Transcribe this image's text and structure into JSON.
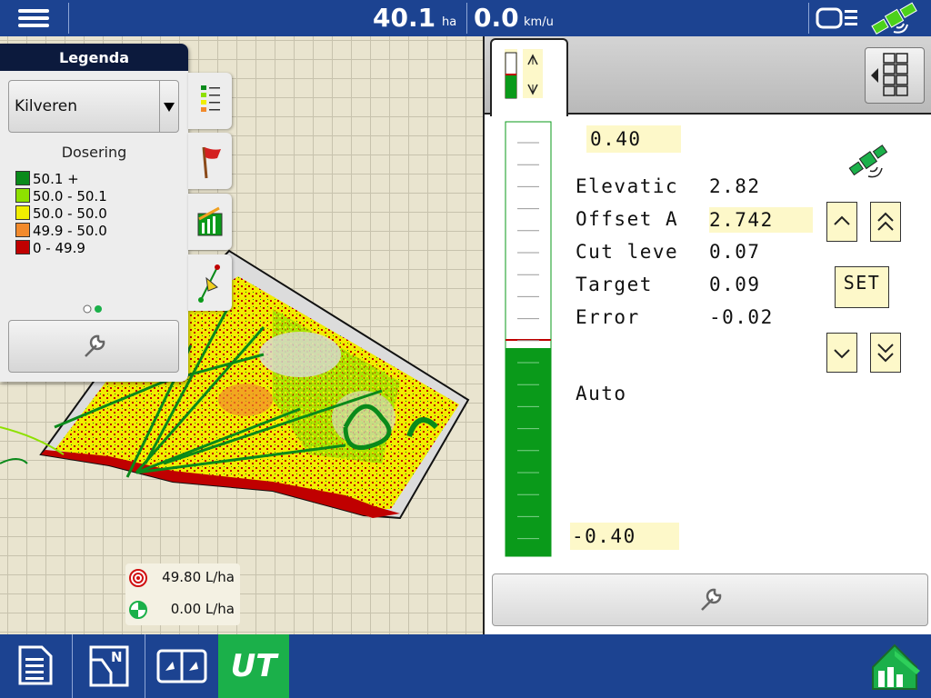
{
  "topbar": {
    "area_value": "40.1",
    "area_unit": "ha",
    "speed_value": "0.0",
    "speed_unit": "km/u",
    "icons": [
      "menu-icon",
      "implement-icon",
      "gps-satellite-icon"
    ]
  },
  "legend": {
    "title": "Legenda",
    "layer": "Kilveren",
    "subtitle": "Dosering",
    "items": [
      {
        "label": "50.1 +",
        "color": "#0a8a1a"
      },
      {
        "label": "50.0 - 50.1",
        "color": "#8ee000"
      },
      {
        "label": "50.0 - 50.0",
        "color": "#f0ee00"
      },
      {
        "label": "49.9 - 50.0",
        "color": "#f28a2c"
      },
      {
        "label": "0 - 49.9",
        "color": "#c00000"
      }
    ],
    "side_tabs": [
      "legend-list-icon",
      "flag-icon",
      "chart-icon",
      "guidance-icon"
    ]
  },
  "rates": {
    "target": "49.80 L/ha",
    "actual": "0.00 L/ha"
  },
  "grade_control": {
    "bar_top": "0.40",
    "bar_bottom": "-0.40",
    "bar_fill": 0.5,
    "rows": [
      {
        "label": "Elevatic",
        "value": "2.82",
        "highlight": false
      },
      {
        "label": "Offset A",
        "value": "2.742",
        "highlight": true
      },
      {
        "label": "Cut leve",
        "value": "0.07",
        "highlight": false
      },
      {
        "label": "Target",
        "value": "0.09",
        "highlight": false
      },
      {
        "label": "Error",
        "value": "-0.02",
        "highlight": false
      }
    ],
    "mode": "Auto",
    "set_label": "SET"
  },
  "bottombar": {
    "ut_label": "UT",
    "buttons": [
      "document-icon",
      "field-map-icon",
      "split-screen-icon",
      "ut-button",
      "home-icon"
    ]
  },
  "colors": {
    "bar_blue": "#1c4391",
    "ut_green": "#1bb04a",
    "fill_green": "#0a9a1a"
  }
}
